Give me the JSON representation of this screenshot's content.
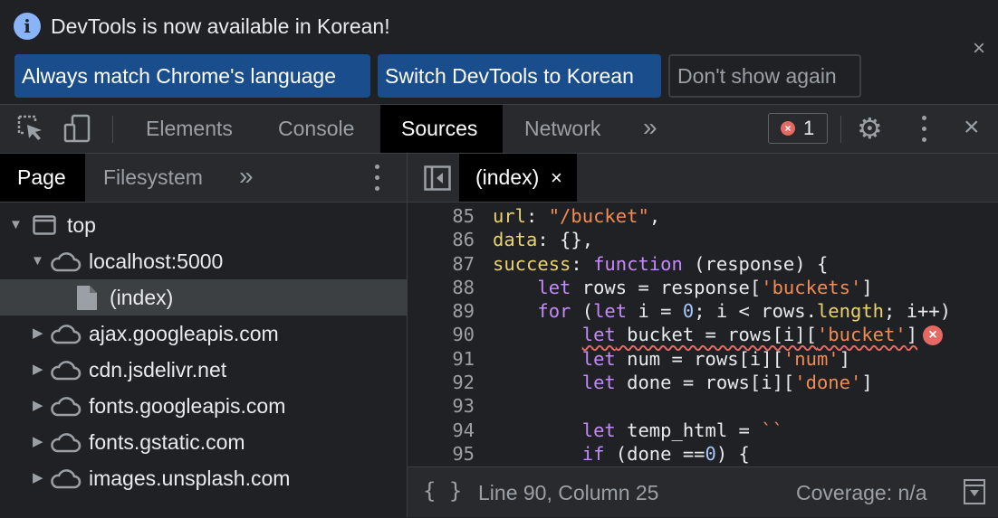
{
  "infobar": {
    "message": "DevTools is now available in Korean!",
    "buttons": {
      "always_match": "Always match Chrome's language",
      "switch": "Switch DevTools to Korean",
      "dont_show": "Don't show again"
    },
    "close_glyph": "×"
  },
  "toolbar": {
    "tabs": [
      "Elements",
      "Console",
      "Sources",
      "Network"
    ],
    "active_tab": "Sources",
    "more_glyph": "»",
    "error_count": "1"
  },
  "navigator": {
    "tabs": [
      "Page",
      "Filesystem"
    ],
    "active_tab": "Page",
    "more_glyph": "»",
    "tree": [
      {
        "label": "top",
        "type": "frame",
        "expanded": true
      },
      {
        "label": "localhost:5000",
        "type": "domain",
        "expanded": true
      },
      {
        "label": "(index)",
        "type": "file",
        "selected": true
      },
      {
        "label": "ajax.googleapis.com",
        "type": "domain",
        "expanded": false
      },
      {
        "label": "cdn.jsdelivr.net",
        "type": "domain",
        "expanded": false
      },
      {
        "label": "fonts.googleapis.com",
        "type": "domain",
        "expanded": false
      },
      {
        "label": "fonts.gstatic.com",
        "type": "domain",
        "expanded": false
      },
      {
        "label": "images.unsplash.com",
        "type": "domain",
        "expanded": false
      }
    ]
  },
  "editor": {
    "tab_label": "(index)",
    "tab_close": "×",
    "line_numbers": [
      "85",
      "86",
      "87",
      "88",
      "89",
      "90",
      "91",
      "92",
      "93",
      "94",
      "95"
    ],
    "error_line": "90"
  },
  "statusbar": {
    "pretty_print": "{ }",
    "position": "Line 90, Column 25",
    "coverage": "Coverage: n/a"
  },
  "colors": {
    "background": "#202124",
    "primary_button": "#1a4d8c",
    "error": "#e46962",
    "property": "#e9d36f",
    "string": "#f28b54",
    "keyword": "#c58af9",
    "number": "#a8c7fa"
  }
}
